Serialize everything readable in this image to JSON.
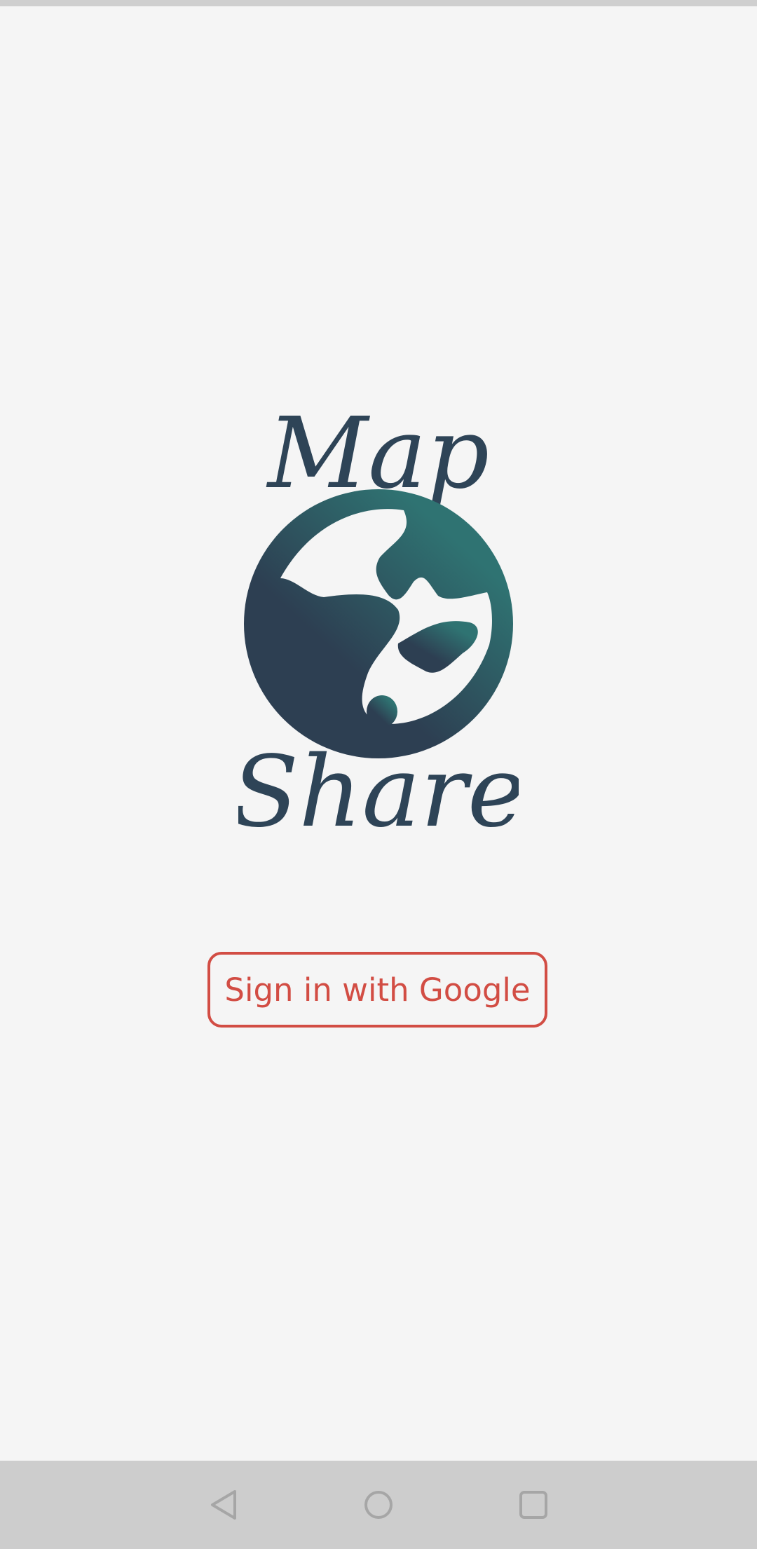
{
  "app": {
    "logo_top_word": "Map",
    "logo_bottom_word": "Share"
  },
  "auth": {
    "signin_label": "Sign in with Google"
  },
  "nav": {
    "back_icon": "back-triangle",
    "home_icon": "home-circle",
    "recents_icon": "recents-square"
  },
  "colors": {
    "background": "#f5f5f5",
    "brand_dark": "#2e4457",
    "brand_teal": "#2f7372",
    "accent_red": "#d24d44",
    "system_bar": "#cdcdcd"
  }
}
